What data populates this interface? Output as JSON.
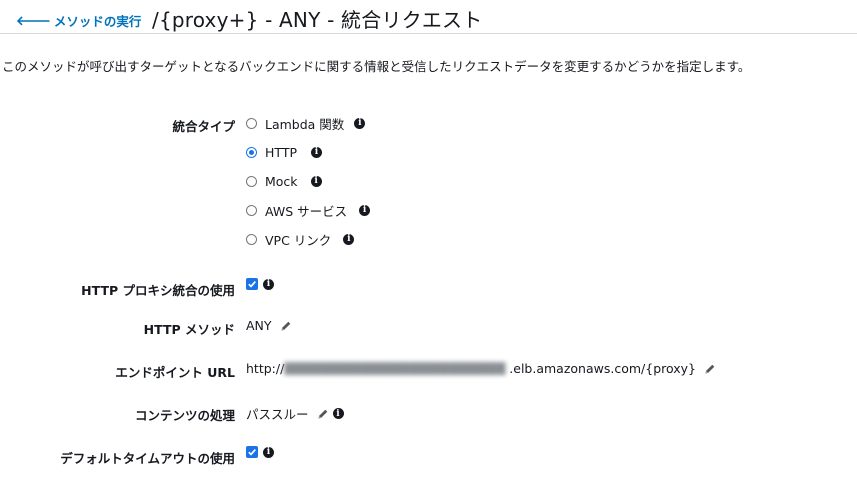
{
  "header": {
    "back_label": "メソッドの実行",
    "title": "/{proxy+} - ANY - 統合リクエスト"
  },
  "description": "このメソッドが呼び出すターゲットとなるバックエンドに関する情報と受信したリクエストデータを変更するかどうかを指定します。",
  "integration_type": {
    "label": "統合タイプ",
    "options": [
      {
        "label": "Lambda 関数",
        "selected": false
      },
      {
        "label": "HTTP",
        "selected": true
      },
      {
        "label": "Mock",
        "selected": false
      },
      {
        "label": "AWS サービス",
        "selected": false
      },
      {
        "label": "VPC リンク",
        "selected": false
      }
    ]
  },
  "http_proxy": {
    "label": "HTTP プロキシ統合の使用",
    "checked": true
  },
  "http_method": {
    "label": "HTTP メソッド",
    "value": "ANY"
  },
  "endpoint_url": {
    "label": "エンドポイント URL",
    "prefix": "http://",
    "suffix": ".elb.amazonaws.com/{proxy}"
  },
  "content_handling": {
    "label": "コンテンツの処理",
    "value": "パススルー"
  },
  "default_timeout": {
    "label": "デフォルトタイムアウトの使用",
    "checked": true
  },
  "colors": {
    "link": "#0073bb",
    "accent": "#1a73e8",
    "text": "#16191f",
    "divider": "#d5dbdb"
  }
}
